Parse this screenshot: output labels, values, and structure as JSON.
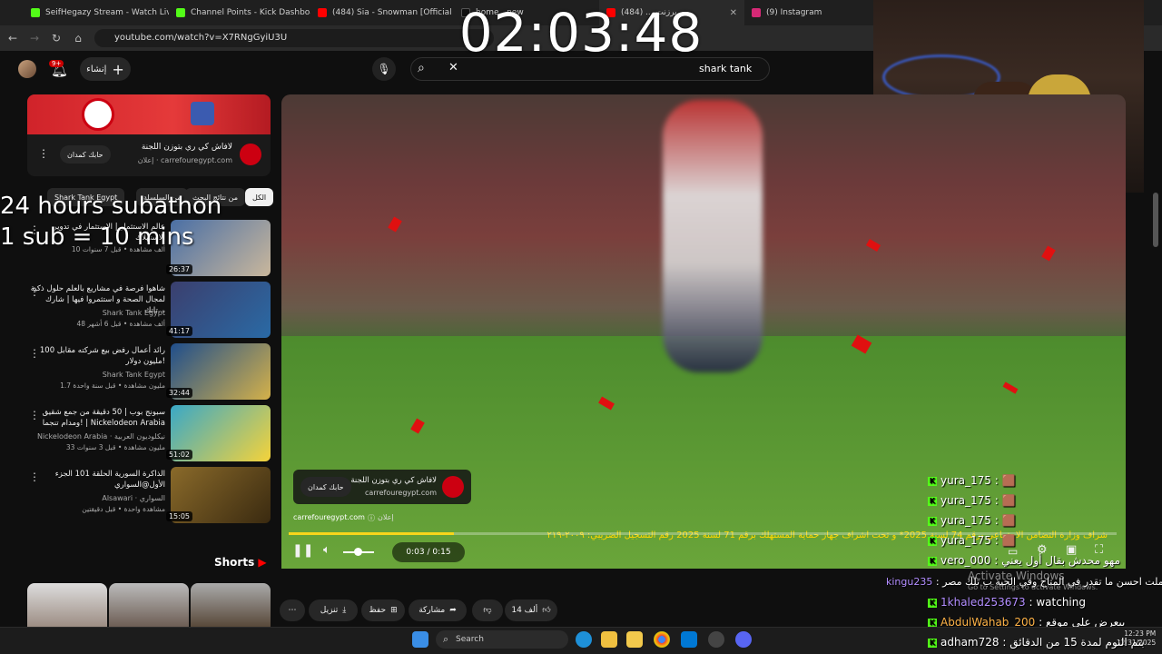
{
  "browser": {
    "tabs": [
      {
        "label": "SeifHegazy Stream - Watch Liv",
        "color": "#53fc18"
      },
      {
        "label": "Channel Points - Kick Dashboa",
        "color": "#53fc18"
      },
      {
        "label": "(484) Sia - Snowman [Official V",
        "color": "#ff0000"
      },
      {
        "label": "home.. new",
        "color": "#111111"
      },
      {
        "label": "(484) ... برزنت",
        "color": "#ff0000"
      },
      {
        "label": "(9) Instagram",
        "color": "#d62976"
      }
    ],
    "url": "youtube.com/watch?v=X7RNgGyiU3U"
  },
  "timer": "02:03:48",
  "header": {
    "create_label": "إنشاء",
    "notif_count": "9+",
    "search_value": "shark tank"
  },
  "overlay": {
    "line1": "24 hours subathon",
    "line2": "1 sub = 10 mins"
  },
  "sidebar": {
    "ad": {
      "title": "لافاش كي ري بتوزن اللجنة",
      "sponsor": "إعلان · carrefouregypt.com",
      "cta": "حابك كمدان"
    },
    "chips": [
      "الكل",
      "من نتائج البحث",
      "من السلسلة",
      "Shark Tank Egypt"
    ],
    "recs": [
      {
        "title": "عالم الاستثمار | الاستثمار في تدوير الاستهلاك",
        "channel": "",
        "meta": "10 ألف مشاهدة • قبل 7 سنوات",
        "duration": "26:37",
        "thumb": "#4a6fa5"
      },
      {
        "title": "شاهوا فرصة في مشاريع بالعلم حلول ذكية لمجال الصحة و استثمروا فيها | شارك تاتك...",
        "channel": "Shark Tank Egypt",
        "meta": "48 ألف مشاهدة • قبل 6 أشهر",
        "duration": "41:17",
        "thumb": "#3b3f6e"
      },
      {
        "title": "رائد أعمال رفض بيع شركته مقابل 100 مليون دولار!",
        "channel": "Shark Tank Egypt",
        "meta": "1.7 مليون مشاهدة • قبل سنة واحدة",
        "duration": "32:44",
        "thumb": "#1f4e8c"
      },
      {
        "title": "سبونج بوب | 50 دقيقة من جمع شقيق ومدام تنجما! | Nickelodeon Arabia",
        "channel": "Nickelodeon Arabia · نيكلوديون العربية",
        "meta": "33 مليون مشاهدة • قبل 3 سنوات",
        "duration": "51:02",
        "thumb": "#39a8c7"
      },
      {
        "title": "الذاكرة السورية الحلقة 101 الجزء الأول@السواري",
        "channel": "Alsawari · السواري",
        "meta": "مشاهدة واحدة • قبل دقيقتين",
        "duration": "15:05",
        "thumb": "#8a6a2a"
      }
    ],
    "shorts_label": "Shorts"
  },
  "video": {
    "ad_title": "لافاش كي ري بتوزن اللجنة",
    "ad_url_small": "carrefouregypt.com",
    "ad_cta": "حابك كمدان",
    "ad_domain": "carrefouregypt.com",
    "ad_tag": "إعلان",
    "marquee": "شراف وزارة التضامن الاجتماعي برقم 74 لسنة 2025* و تحت اشراف جهاز حماية المستهلك برقم 71 لسنة 2025 رقم التسجيل الضريبي: ٢٠٠٩-٢١٩",
    "time": "0:03 / 0:15",
    "progress": 0.2
  },
  "actions": {
    "like": "14 ألف",
    "share": "مشاركة",
    "save": "حفظ",
    "download": "تنزيل"
  },
  "chat": [
    {
      "user": "yura_175",
      "msg": " : 🟫"
    },
    {
      "user": "yura_175",
      "msg": " : 🟫"
    },
    {
      "user": "yura_175",
      "msg": " : 🟫"
    },
    {
      "user": "yura_175",
      "msg": " : 🟫"
    },
    {
      "user": "vero_000",
      "msg": " : مهو محدش بقال أول يعني"
    },
    {
      "user": "kingu235",
      "msg": " : انت عملت احسن ما تقدر في المتاح وفي الحبة ب تلك مصر"
    },
    {
      "user": "1khaled253673",
      "msg": " : watching"
    },
    {
      "user": "AbdulWahab_200",
      "msg": " : بيعرض على موقع"
    },
    {
      "user": "adham728",
      "msg": " : بتم النوم لمدة 15 من الدقائق"
    }
  ],
  "system": {
    "activate_title": "Activate Windows",
    "activate_sub": "Go to Settings to activate Windows.",
    "taskbar_search": "Search",
    "time": "12:23 PM",
    "date": "12/31/2025"
  }
}
